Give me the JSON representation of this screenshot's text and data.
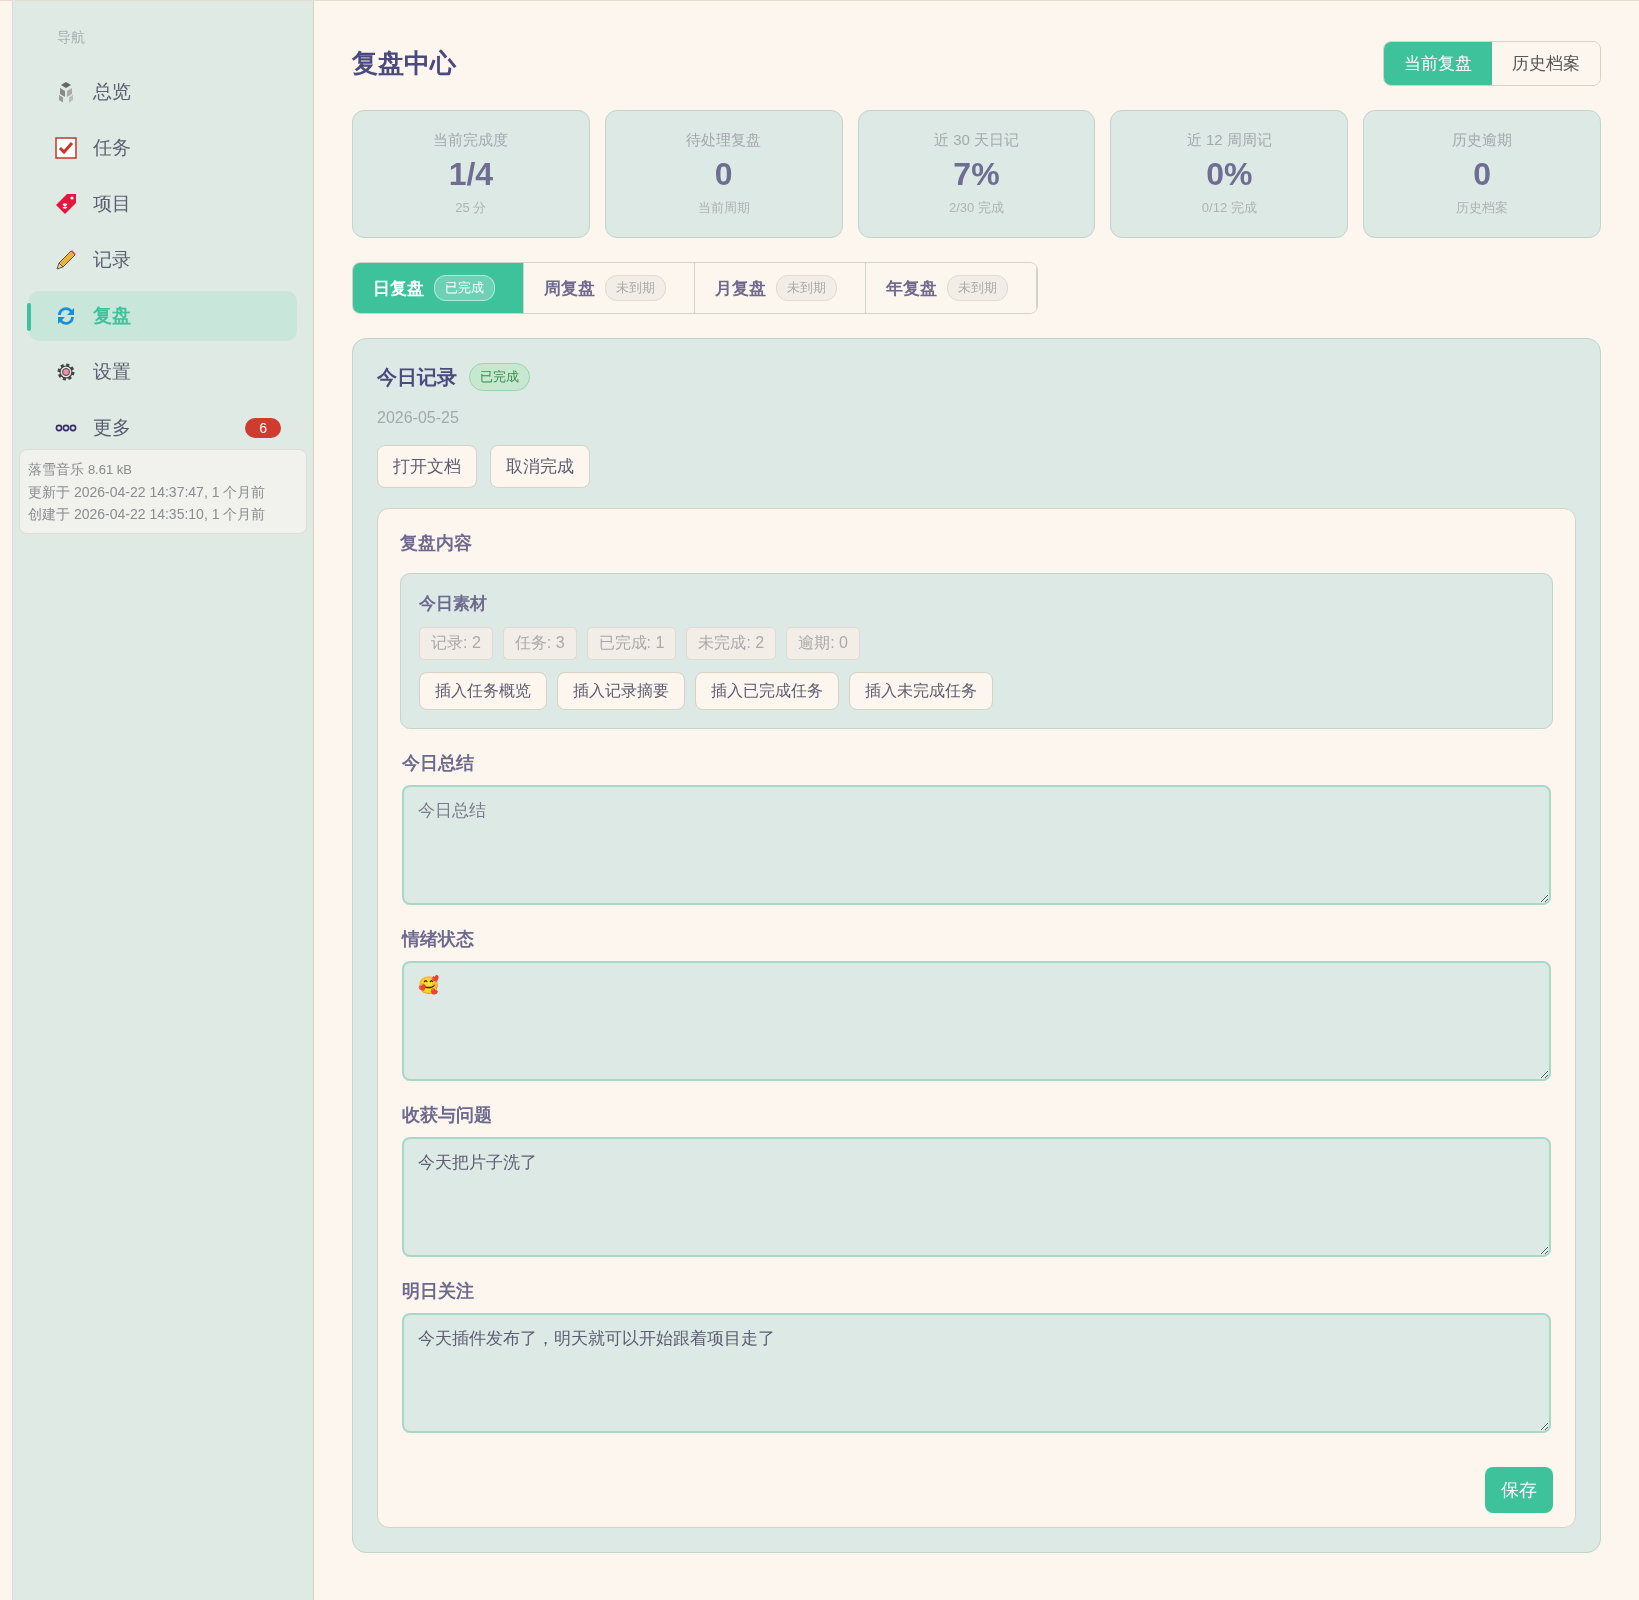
{
  "sidebar": {
    "heading": "导航",
    "items": [
      {
        "label": "总览",
        "selected": false
      },
      {
        "label": "任务",
        "selected": false
      },
      {
        "label": "项目",
        "selected": false
      },
      {
        "label": "记录",
        "selected": false
      },
      {
        "label": "复盘",
        "selected": true
      },
      {
        "label": "设置",
        "selected": false
      },
      {
        "label": "更多",
        "selected": false,
        "badge": "6"
      }
    ],
    "tooltip": {
      "title": "落雪音乐",
      "size": "8.61 kB",
      "lines": [
        "更新于 2026-04-22 14:37:47, 1 个月前",
        "创建于 2026-04-22 14:35:10, 1 个月前"
      ]
    }
  },
  "page": {
    "title": "复盘中心",
    "views": [
      {
        "label": "当前复盘",
        "selected": true
      },
      {
        "label": "历史档案",
        "selected": false
      }
    ]
  },
  "stats": [
    {
      "label": "当前完成度",
      "value": "1/4",
      "sub": "25 分"
    },
    {
      "label": "待处理复盘",
      "value": "0",
      "sub": "当前周期"
    },
    {
      "label": "近 30 天日记",
      "value": "7%",
      "sub": "2/30 完成"
    },
    {
      "label": "近 12 周周记",
      "value": "0%",
      "sub": "0/12 完成"
    },
    {
      "label": "历史逾期",
      "value": "0",
      "sub": "历史档案"
    }
  ],
  "tabs": [
    {
      "label": "日复盘",
      "badge": "已完成",
      "selected": true
    },
    {
      "label": "周复盘",
      "badge": "未到期",
      "selected": false
    },
    {
      "label": "月复盘",
      "badge": "未到期",
      "selected": false
    },
    {
      "label": "年复盘",
      "badge": "未到期",
      "selected": false
    }
  ],
  "record": {
    "title": "今日记录",
    "status": "已完成",
    "date": "2026-05-25",
    "actions": [
      "打开文档",
      "取消完成"
    ],
    "content": {
      "title": "复盘内容",
      "material": {
        "title": "今日素材",
        "counts": [
          "记录: 2",
          "任务: 3",
          "已完成: 1",
          "未完成: 2",
          "逾期: 0"
        ],
        "inserts": [
          "插入任务概览",
          "插入记录摘要",
          "插入已完成任务",
          "插入未完成任务"
        ]
      },
      "fields": [
        {
          "label": "今日总结",
          "placeholder": "今日总结"
        },
        {
          "label": "情绪状态",
          "value": "🥰"
        },
        {
          "label": "收获与问题",
          "value": "今天把片子洗了"
        },
        {
          "label": "明日关注",
          "value": "今天插件发布了，明天就可以开始跟着项目走了"
        }
      ],
      "save": "保存"
    }
  }
}
